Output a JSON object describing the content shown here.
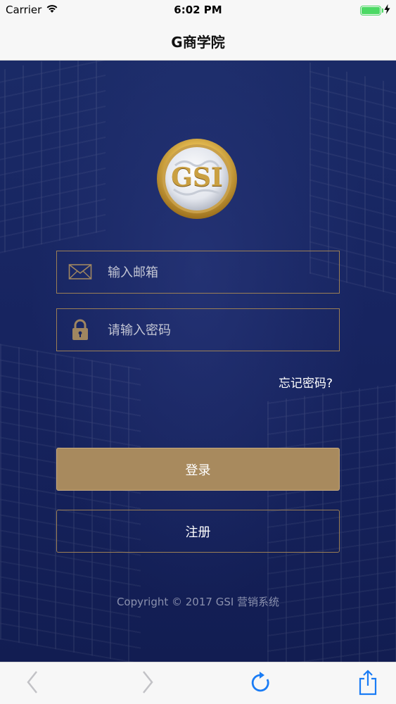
{
  "status_bar": {
    "carrier": "Carrier",
    "time": "6:02 PM",
    "battery_level": 1.0
  },
  "nav": {
    "title": "G商学院"
  },
  "logo": {
    "text": "GSI",
    "icon": "gsi-globe-logo"
  },
  "login_form": {
    "email": {
      "placeholder": "输入邮箱",
      "value": "",
      "icon": "envelope-icon"
    },
    "password": {
      "placeholder": "请输入密码",
      "value": "",
      "icon": "lock-icon"
    },
    "forgot_label": "忘记密码?",
    "login_label": "登录",
    "register_label": "注册"
  },
  "footer": {
    "copyright": "Copyright © 2017 GSI 营销系统"
  },
  "toolbar": {
    "back_icon": "chevron-left-icon",
    "forward_icon": "chevron-right-icon",
    "reload_icon": "reload-icon",
    "share_icon": "share-icon"
  },
  "colors": {
    "background_dark": "#172460",
    "gold_accent": "#a88a5e",
    "gold_border": "#9c7f55",
    "ios_blue": "#1a7cf5",
    "battery_green": "#4cd964"
  }
}
